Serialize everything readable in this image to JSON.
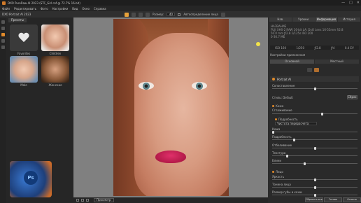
{
  "window": {
    "title": "DXO PureRaw AI 2023 (STC_Girl.raf @ 72.7% 16-bit)",
    "controls": [
      "—",
      "□",
      "✕"
    ]
  },
  "menu": [
    "Файл",
    "Редактировать",
    "Фото",
    "Настройки",
    "Вид",
    "Окно",
    "Справка"
  ],
  "toolbar": {
    "app_label": "DXO Portrait AI 2023",
    "size_label": "Размер:",
    "size_value": "40",
    "auto_label": "Автоопределение лица"
  },
  "presets": {
    "tab_label": "Пресеты",
    "items": [
      {
        "label": "Favorites"
      },
      {
        "label": "Children"
      },
      {
        "label": "Male"
      },
      {
        "label": "Женские"
      }
    ]
  },
  "right": {
    "tabs": [
      "Нав.",
      "Уровни",
      "Информация",
      "История"
    ],
    "active_tab": 2,
    "info_lines": [
      "НАЗВАНИЕ",
      "FUJI XHS-2 RAW 16-bit  LA: DxO Lens 16-55mm f/2.8",
      "50.0 mm  ƒ/2.8  1/125s  ISO 200",
      "0-30.7 МБ"
    ],
    "histogram_values": [
      "ISO 160",
      "1/250",
      "ƒ/2.8",
      "ƒ/4",
      "0.4 EV"
    ],
    "section_title": "Настройки приложения",
    "subtabs": [
      "Основной",
      "Местный"
    ],
    "plugin_name": "Portrait AI",
    "slider_main_label": "Сопоставление",
    "preset_label": "Стиль: Default",
    "preset_button": "Сброс",
    "skin_section": "Кожа",
    "skin_smoothing": "Сглаживание",
    "smooth_mode": "Подробность",
    "smooth_dropdown": "Чистота перерасчета",
    "sliders": [
      "Кожа",
      "Подробность",
      "Отбеливание",
      "Текстура",
      "Блики"
    ],
    "teeth_section": "Лицо",
    "teeth_sliders": [
      "Яркость",
      "Тонина лица",
      "Размер губы и кожи"
    ]
  },
  "bottom": {
    "preview_label": "Просмотр"
  },
  "footer_buttons": [
    "Сбросить все",
    "Готово",
    "Отмена"
  ],
  "watermark": {
    "text": "Ps"
  }
}
